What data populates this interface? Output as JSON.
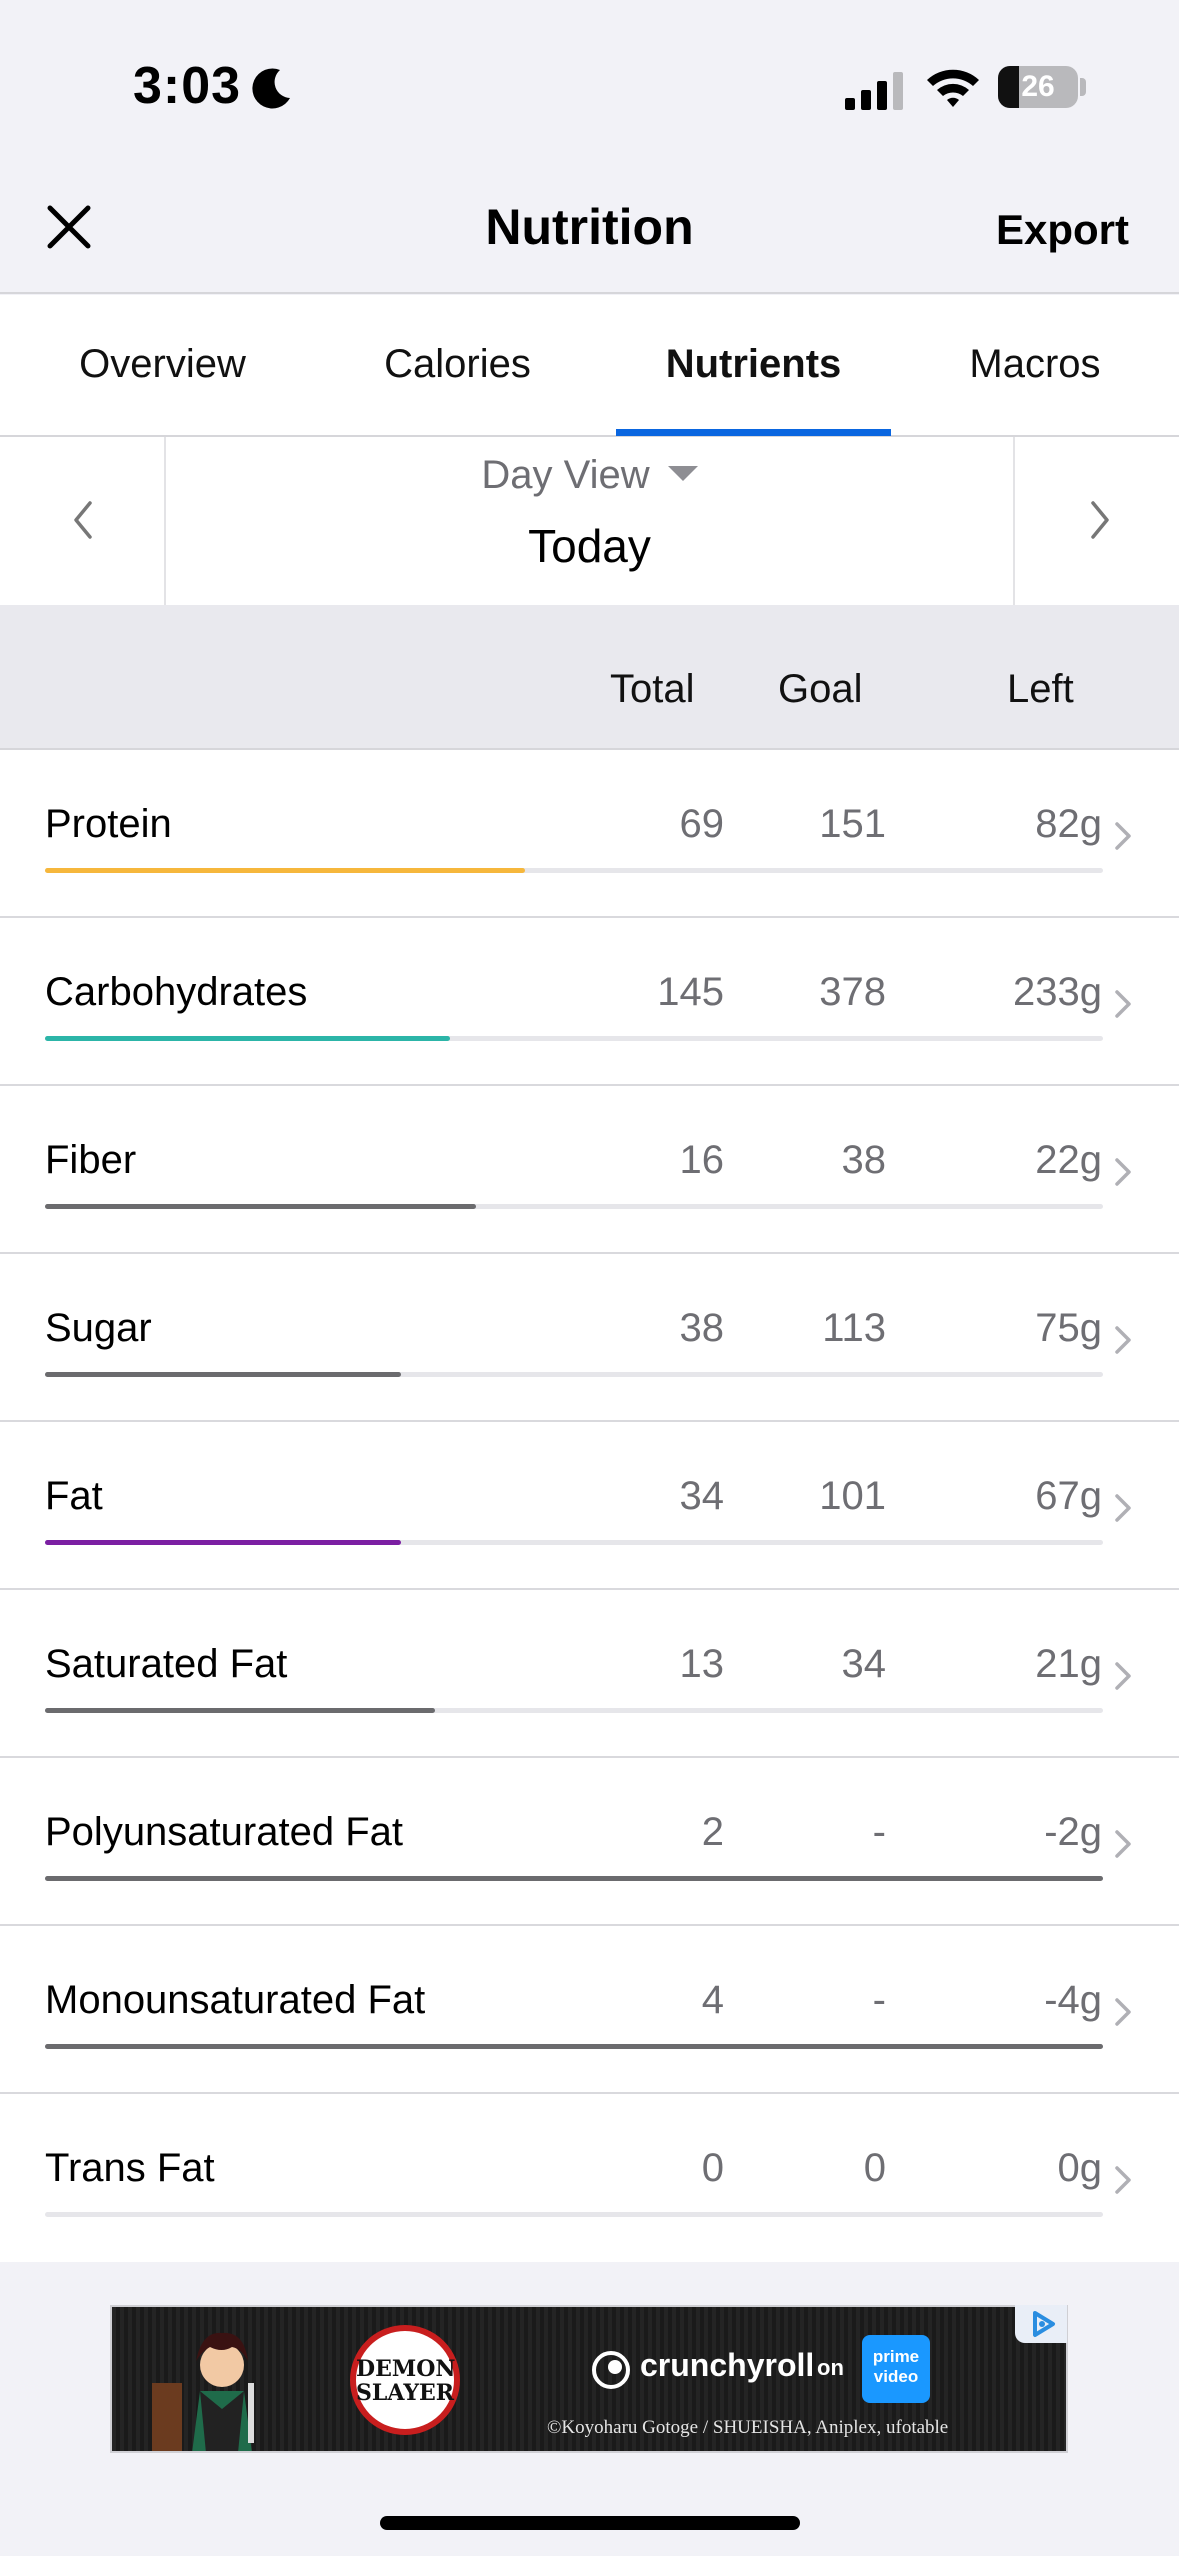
{
  "status_bar": {
    "time": "3:03",
    "battery": "26",
    "battery_fraction": 0.26
  },
  "nav": {
    "title": "Nutrition",
    "export_label": "Export"
  },
  "tabs": [
    {
      "label": "Overview",
      "active": false
    },
    {
      "label": "Calories",
      "active": false
    },
    {
      "label": "Nutrients",
      "active": true
    },
    {
      "label": "Macros",
      "active": false
    }
  ],
  "date_nav": {
    "view_label": "Day View",
    "date_label": "Today"
  },
  "columns": {
    "total": "Total",
    "goal": "Goal",
    "left": "Left"
  },
  "nutrients": [
    {
      "name": "Protein",
      "total": "69",
      "goal": "151",
      "left": "82g",
      "progress": 0.4536,
      "color": "#f6b73c"
    },
    {
      "name": "Carbohydrates",
      "total": "145",
      "goal": "378",
      "left": "233g",
      "progress": 0.3825,
      "color": "#2cb5a8"
    },
    {
      "name": "Fiber",
      "total": "16",
      "goal": "38",
      "left": "22g",
      "progress": 0.4078,
      "color": "#6b6b6e"
    },
    {
      "name": "Sugar",
      "total": "38",
      "goal": "113",
      "left": "75g",
      "progress": 0.3369,
      "color": "#6b6b6e"
    },
    {
      "name": "Fat",
      "total": "34",
      "goal": "101",
      "left": "67g",
      "progress": 0.3369,
      "color": "#7b1fa2"
    },
    {
      "name": "Saturated Fat",
      "total": "13",
      "goal": "34",
      "left": "21g",
      "progress": 0.369,
      "color": "#6b6b6e"
    },
    {
      "name": "Polyunsaturated Fat",
      "total": "2",
      "goal": "-",
      "left": "-2g",
      "progress": 1.0,
      "color": "#6b6b6e"
    },
    {
      "name": "Monounsaturated Fat",
      "total": "4",
      "goal": "-",
      "left": "-4g",
      "progress": 1.0,
      "color": "#6b6b6e"
    },
    {
      "name": "Trans Fat",
      "total": "0",
      "goal": "0",
      "left": "0g",
      "progress": 0.0,
      "color": "#6b6b6e"
    }
  ],
  "ad": {
    "logo_text_line1": "DEMON",
    "logo_text_line2": "SLAYER",
    "brand": "crunchyroll",
    "on": "on",
    "partner": "prime video",
    "credit": "©Koyoharu Gotoge / SHUEISHA, Aniplex, ufotable"
  }
}
